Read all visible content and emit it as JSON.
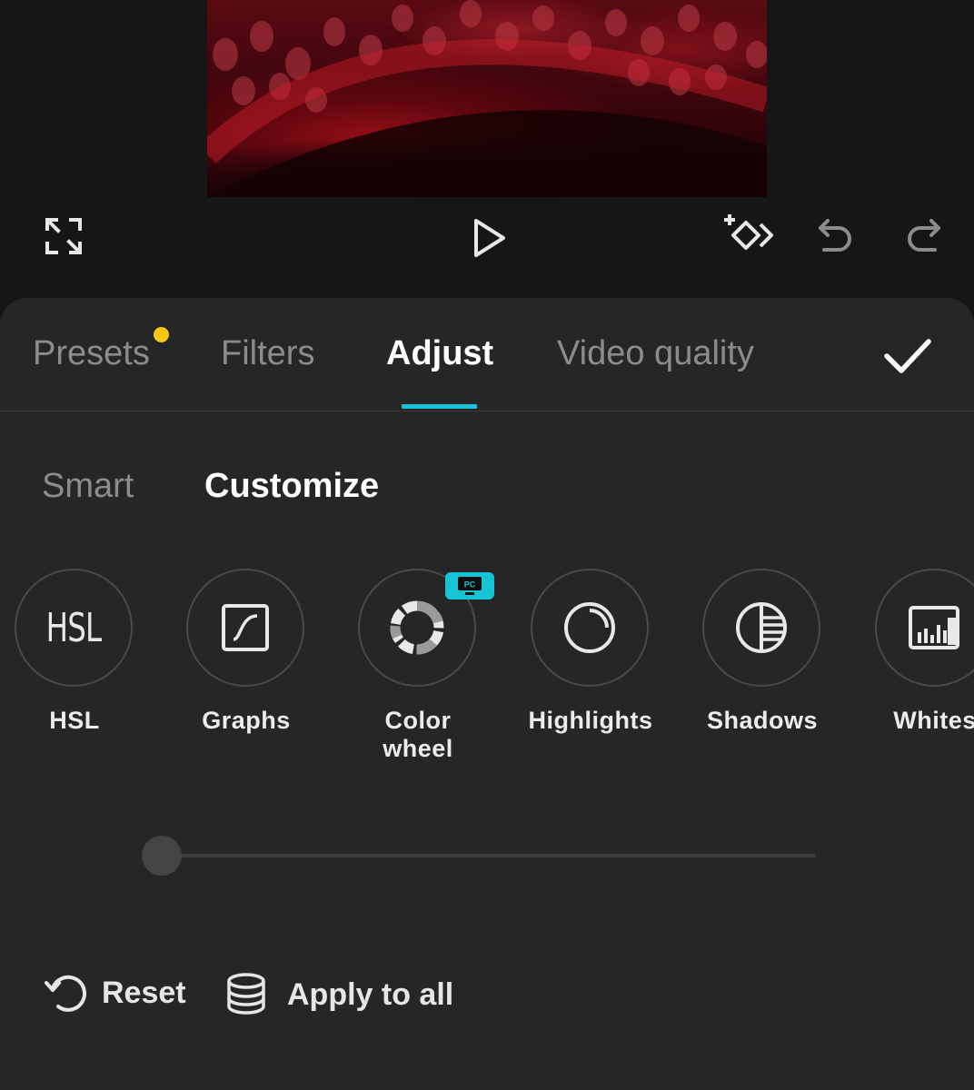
{
  "player": {
    "fullscreen_icon": "fullscreen-icon",
    "play_icon": "play-icon",
    "keyframe_icon": "add-keyframe-icon",
    "undo_icon": "undo-icon",
    "redo_icon": "redo-icon"
  },
  "tabs": [
    {
      "label": "Presets",
      "has_new_dot": true
    },
    {
      "label": "Filters"
    },
    {
      "label": "Adjust",
      "active": true
    },
    {
      "label": "Video quality"
    }
  ],
  "subtabs": [
    {
      "label": "Smart"
    },
    {
      "label": "Customize",
      "active": true
    }
  ],
  "tools": [
    {
      "label": "HSL",
      "icon_text": "HSL",
      "icon": "hsl-icon"
    },
    {
      "label": "Graphs",
      "icon": "graphs-icon"
    },
    {
      "label": "Color\nwheel",
      "label_line1": "Color",
      "label_line2": "wheel",
      "icon": "color-wheel-icon",
      "badge": "PC"
    },
    {
      "label": "Highlights",
      "icon": "highlights-icon"
    },
    {
      "label": "Shadows",
      "icon": "shadows-icon"
    },
    {
      "label": "Whites",
      "icon": "whites-icon"
    }
  ],
  "slider": {
    "value_fraction": 0.0
  },
  "actions": {
    "reset_label": "Reset",
    "apply_all_label": "Apply to all"
  },
  "colors": {
    "accent": "#16c4d6",
    "new_dot": "#f5c518",
    "panel_bg": "#262626",
    "app_bg": "#161616"
  }
}
